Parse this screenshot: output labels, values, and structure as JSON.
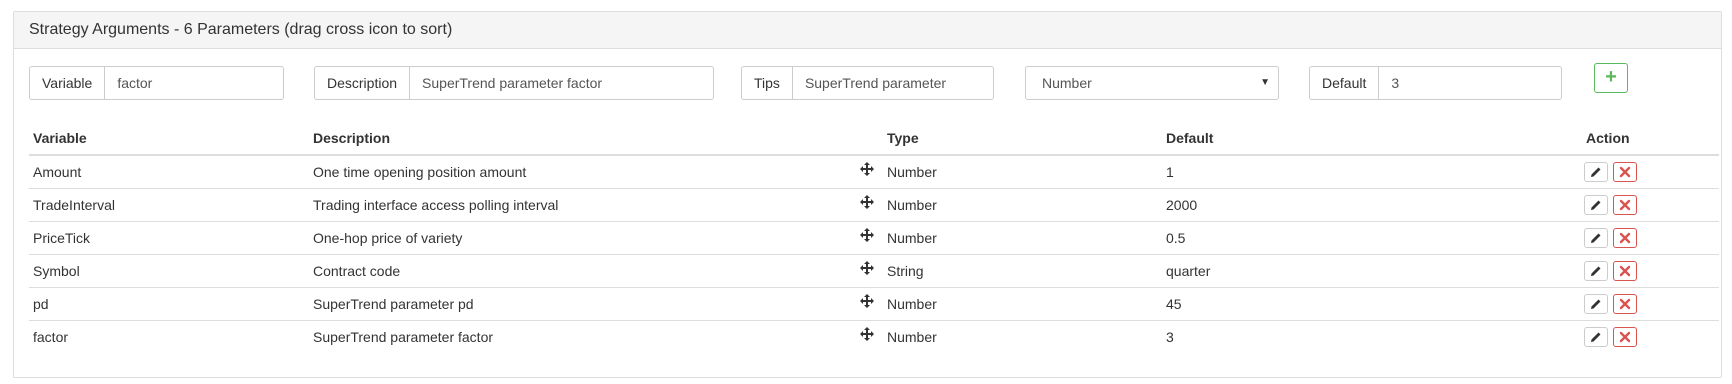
{
  "panel": {
    "title": "Strategy Arguments - 6 Parameters (drag cross icon to sort)"
  },
  "form": {
    "variable_label": "Variable",
    "variable_value": "factor",
    "description_label": "Description",
    "description_value": "SuperTrend parameter factor",
    "tips_label": "Tips",
    "tips_value": "SuperTrend parameter",
    "type_selected": "Number",
    "default_label": "Default",
    "default_value": "3",
    "add_icon": "plus-icon"
  },
  "table": {
    "headers": {
      "variable": "Variable",
      "description": "Description",
      "type": "Type",
      "default": "Default",
      "action": "Action"
    },
    "rows": [
      {
        "variable": "Amount",
        "description": "One time opening position amount",
        "type": "Number",
        "default": "1"
      },
      {
        "variable": "TradeInterval",
        "description": "Trading interface access polling interval",
        "type": "Number",
        "default": "2000"
      },
      {
        "variable": "PriceTick",
        "description": "One-hop price of variety",
        "type": "Number",
        "default": "0.5"
      },
      {
        "variable": "Symbol",
        "description": "Contract code",
        "type": "String",
        "default": "quarter"
      },
      {
        "variable": "pd",
        "description": "SuperTrend parameter pd",
        "type": "Number",
        "default": "45"
      },
      {
        "variable": "factor",
        "description": "SuperTrend parameter factor",
        "type": "Number",
        "default": "3"
      }
    ],
    "icons": {
      "move": "move-icon",
      "edit": "pencil-icon",
      "delete": "close-icon"
    }
  },
  "colors": {
    "success": "#5cb85c",
    "danger": "#d9534f",
    "border": "#dddddd",
    "heading_bg": "#f5f5f5"
  }
}
